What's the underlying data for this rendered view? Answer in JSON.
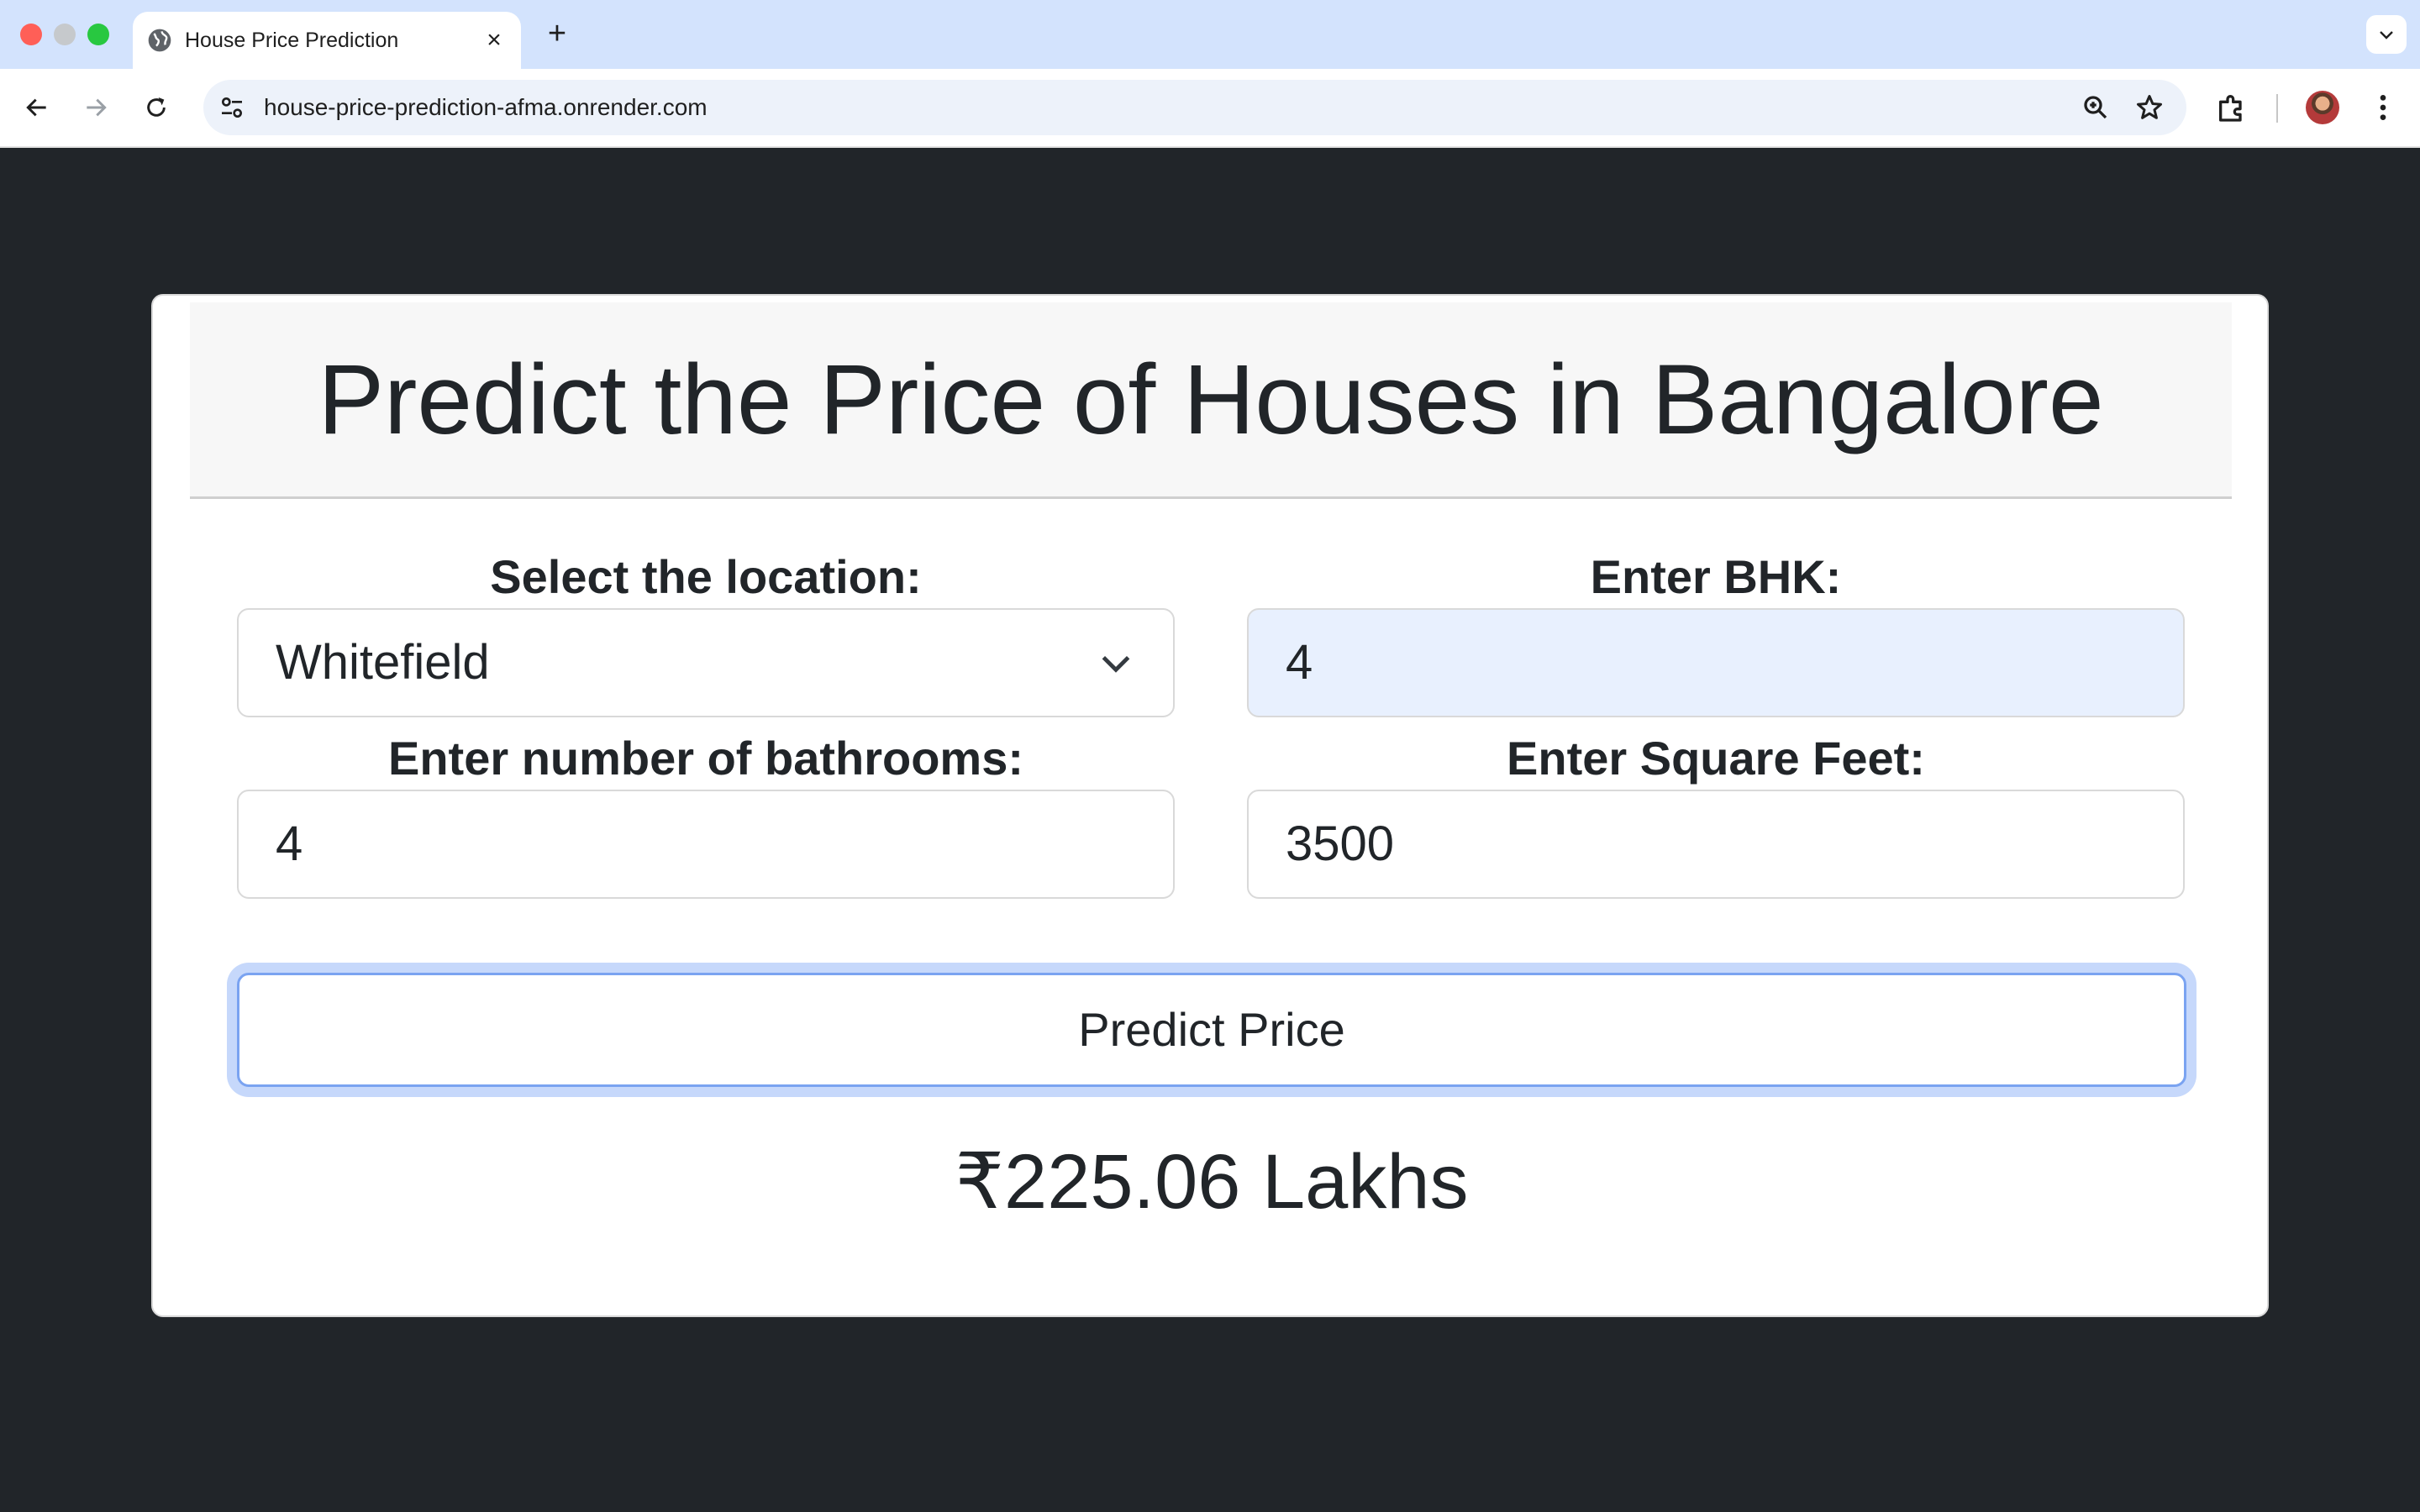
{
  "browser": {
    "tab_title": "House Price Prediction",
    "url": "house-price-prediction-afma.onrender.com",
    "icons": [
      "globe-icon",
      "close-icon",
      "plus-icon",
      "chevron-down-icon",
      "back-arrow-icon",
      "forward-arrow-icon",
      "reload-icon",
      "site-settings-icon",
      "zoom-icon",
      "star-icon",
      "extensions-icon",
      "profile-avatar",
      "more-vert-icon"
    ]
  },
  "page": {
    "title": "Predict the Price of Houses in Bangalore",
    "location": {
      "label": "Select the location:",
      "selected": "Whitefield"
    },
    "bhk": {
      "label": "Enter BHK:",
      "value": "4"
    },
    "bathrooms": {
      "label": "Enter number of bathrooms:",
      "value": "4"
    },
    "sqft": {
      "label": "Enter Square Feet:",
      "value": "3500"
    },
    "predict_button": "Predict Price",
    "result": "₹225.06 Lakhs"
  },
  "colors": {
    "page_bg": "#212529",
    "card_bg": "#ffffff",
    "autofill_bg": "#e8f0fe",
    "focus_ring": "#c6d8fb"
  }
}
